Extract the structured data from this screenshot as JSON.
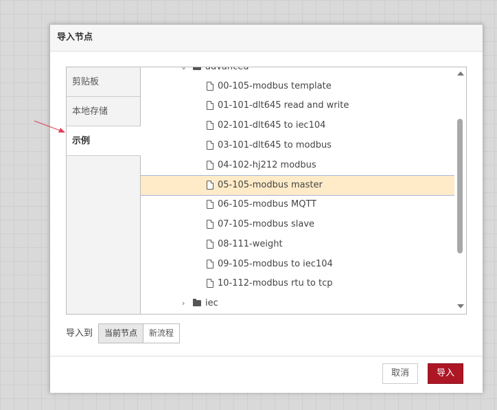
{
  "dialog": {
    "title": "导入节点",
    "tabs": [
      {
        "label": "剪贴板",
        "active": false
      },
      {
        "label": "本地存储",
        "active": false
      },
      {
        "label": "示例",
        "active": true
      }
    ],
    "tree": {
      "folder_top": {
        "label": "advanced",
        "expanded": true
      },
      "files": [
        {
          "label": "00-105-modbus template",
          "selected": false
        },
        {
          "label": "01-101-dlt645 read and write",
          "selected": false
        },
        {
          "label": "02-101-dlt645 to iec104",
          "selected": false
        },
        {
          "label": "03-101-dlt645 to modbus",
          "selected": false
        },
        {
          "label": "04-102-hj212 modbus",
          "selected": false
        },
        {
          "label": "05-105-modbus master",
          "selected": true
        },
        {
          "label": "06-105-modbus MQTT",
          "selected": false
        },
        {
          "label": "07-105-modbus slave",
          "selected": false
        },
        {
          "label": "08-111-weight",
          "selected": false
        },
        {
          "label": "09-105-modbus to iec104",
          "selected": false
        },
        {
          "label": "10-112-modbus rtu to tcp",
          "selected": false
        }
      ],
      "folder_bottom": {
        "label": "iec",
        "expanded": false
      }
    },
    "import_to": {
      "label": "导入到",
      "options": [
        {
          "label": "当前节点",
          "active": true
        },
        {
          "label": "新流程",
          "active": false
        }
      ]
    },
    "buttons": {
      "cancel": "取消",
      "import": "导入"
    }
  },
  "colors": {
    "selected_row": "#ffebc7",
    "primary_button": "#ad1625",
    "annotation_arrow": "#e0405a"
  },
  "icons": {
    "file": "file-icon",
    "folder": "folder-icon",
    "expand": "chevron-down-icon",
    "collapse": "chevron-right-icon"
  }
}
